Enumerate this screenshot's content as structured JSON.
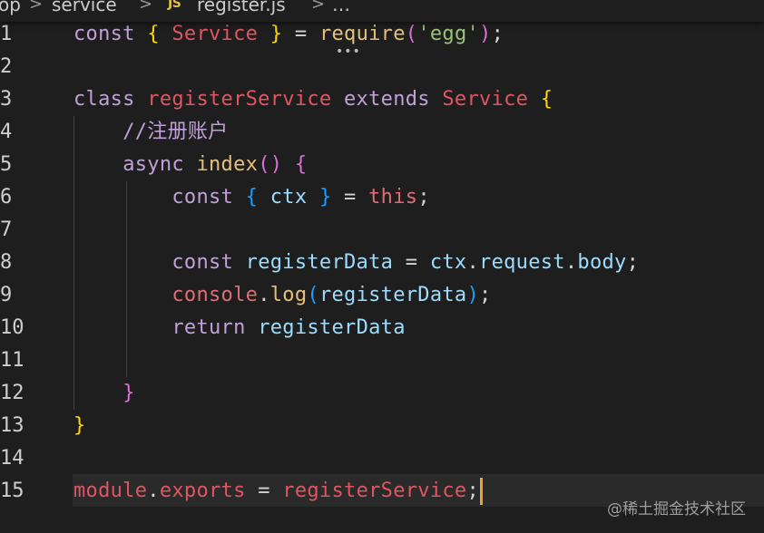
{
  "breadcrumb": {
    "items": [
      "op",
      "service",
      "register.js",
      "…"
    ],
    "separator": ">",
    "file_icon": "JS"
  },
  "editor": {
    "lines": [
      {
        "num": "1",
        "tokens": [
          [
            "const ",
            "kw2"
          ],
          [
            "{ ",
            "brace1"
          ],
          [
            "Service ",
            "cls"
          ],
          [
            "} ",
            "brace1"
          ],
          [
            "= ",
            "punc"
          ],
          [
            "require",
            "fn"
          ],
          [
            "(",
            "brace2"
          ],
          [
            "'egg'",
            "str"
          ],
          [
            ")",
            "brace2"
          ],
          [
            ";",
            "punc"
          ]
        ]
      },
      {
        "num": "2",
        "tokens": []
      },
      {
        "num": "3",
        "tokens": [
          [
            "class ",
            "kw2"
          ],
          [
            "registerService ",
            "cls"
          ],
          [
            "extends ",
            "kw2"
          ],
          [
            "Service ",
            "cls"
          ],
          [
            "{",
            "brace1"
          ]
        ]
      },
      {
        "num": "4",
        "tokens": [
          [
            "    ",
            "punc"
          ],
          [
            "//注册账户",
            "cmt"
          ]
        ]
      },
      {
        "num": "5",
        "tokens": [
          [
            "    ",
            "punc"
          ],
          [
            "async ",
            "kw2"
          ],
          [
            "index",
            "fn"
          ],
          [
            "() ",
            "brace2"
          ],
          [
            "{",
            "brace2"
          ]
        ]
      },
      {
        "num": "6",
        "tokens": [
          [
            "        ",
            "punc"
          ],
          [
            "const ",
            "kw2"
          ],
          [
            "{ ",
            "brace3"
          ],
          [
            "ctx ",
            "var"
          ],
          [
            "} ",
            "brace3"
          ],
          [
            "= ",
            "punc"
          ],
          [
            "this",
            "this"
          ],
          [
            ";",
            "punc"
          ]
        ]
      },
      {
        "num": "7",
        "tokens": []
      },
      {
        "num": "8",
        "tokens": [
          [
            "        ",
            "punc"
          ],
          [
            "const ",
            "kw2"
          ],
          [
            "registerData ",
            "var"
          ],
          [
            "= ",
            "punc"
          ],
          [
            "ctx",
            "var"
          ],
          [
            ".",
            "punc"
          ],
          [
            "request",
            "var"
          ],
          [
            ".",
            "punc"
          ],
          [
            "body",
            "var"
          ],
          [
            ";",
            "punc"
          ]
        ]
      },
      {
        "num": "9",
        "tokens": [
          [
            "        ",
            "punc"
          ],
          [
            "console",
            "this"
          ],
          [
            ".",
            "punc"
          ],
          [
            "log",
            "fn"
          ],
          [
            "(",
            "brace3"
          ],
          [
            "registerData",
            "var"
          ],
          [
            ")",
            "brace3"
          ],
          [
            ";",
            "punc"
          ]
        ]
      },
      {
        "num": "10",
        "tokens": [
          [
            "        ",
            "punc"
          ],
          [
            "return ",
            "kw2"
          ],
          [
            "registerData",
            "var"
          ]
        ]
      },
      {
        "num": "11",
        "tokens": []
      },
      {
        "num": "12",
        "tokens": [
          [
            "    ",
            "punc"
          ],
          [
            "}",
            "brace2"
          ]
        ]
      },
      {
        "num": "13",
        "tokens": [
          [
            "}",
            "brace1"
          ]
        ]
      },
      {
        "num": "14",
        "tokens": []
      },
      {
        "num": "15",
        "tokens": [
          [
            "module",
            "cls"
          ],
          [
            ".",
            "punc"
          ],
          [
            "exports ",
            "cls"
          ],
          [
            "= ",
            "punc"
          ],
          [
            "registerService",
            "cls"
          ],
          [
            ";",
            "punc"
          ]
        ]
      }
    ]
  },
  "watermark": "@稀土掘金技术社区"
}
